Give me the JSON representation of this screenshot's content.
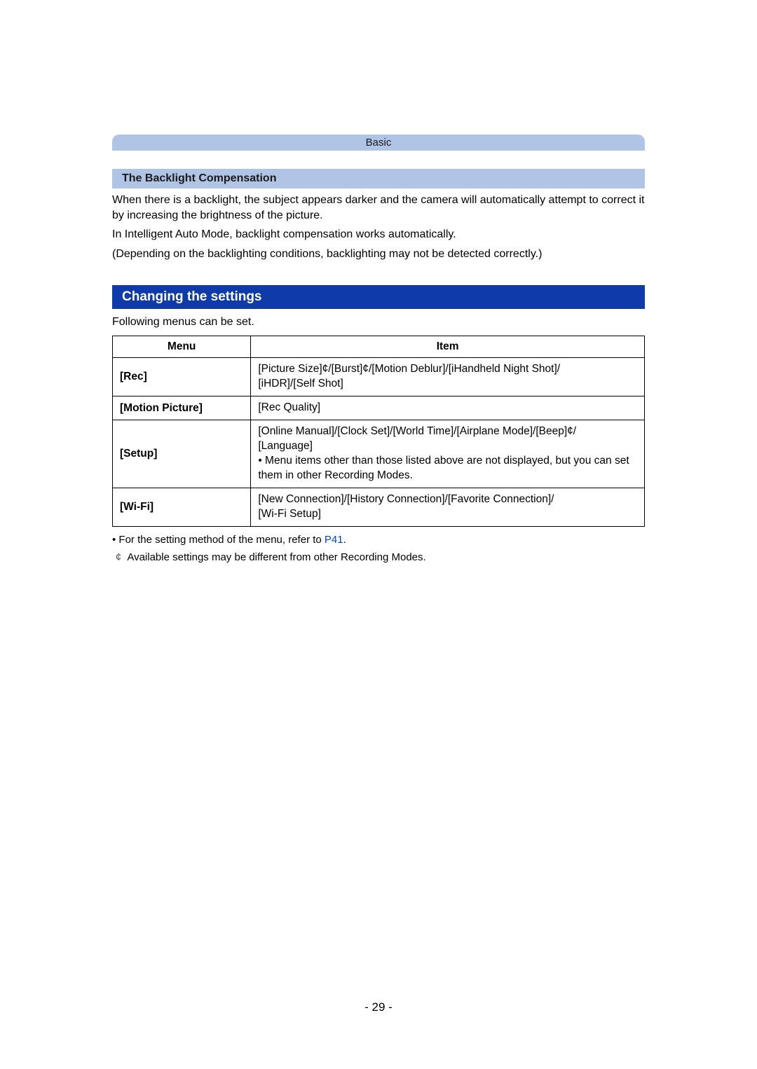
{
  "chapter": "Basic",
  "subsection_title": "The Backlight Compensation",
  "body_paragraphs": [
    "When there is a backlight, the subject appears darker and the camera will automatically attempt to correct it by increasing the brightness of the picture.",
    "In Intelligent Auto Mode, backlight compensation works automatically.",
    "(Depending on the backlighting conditions, backlighting may not be detected correctly.)"
  ],
  "section_heading": "Changing the settings",
  "intro_text": "Following menus can be set.",
  "table": {
    "headers": [
      "Menu",
      "Item"
    ],
    "rows": [
      {
        "menu": "[Rec]",
        "item_lines": [
          "[Picture Size]¢/[Burst]¢/[Motion Deblur]/[iHandheld Night Shot]/",
          "[iHDR]/[Self Shot]"
        ]
      },
      {
        "menu": "[Motion Picture]",
        "item_lines": [
          "[Rec Quality]"
        ]
      },
      {
        "menu": "[Setup]",
        "item_lines": [
          "[Online Manual]/[Clock Set]/[World Time]/[Airplane Mode]/[Beep]¢/",
          "[Language]",
          "• Menu items other than those listed above are not displayed, but you can set them in other Recording Modes."
        ]
      },
      {
        "menu": "[Wi-Fi]",
        "item_lines": [
          "[New Connection]/[History Connection]/[Favorite Connection]/",
          "[Wi-Fi Setup]"
        ]
      }
    ]
  },
  "footnote_prefix": "• For the setting method of the menu, refer to ",
  "footnote_link": "P41",
  "footnote_suffix": ".",
  "asterisk_symbol": "¢",
  "asterisk_note": "Available settings may be different from other Recording Modes.",
  "page_number": "- 29 -"
}
